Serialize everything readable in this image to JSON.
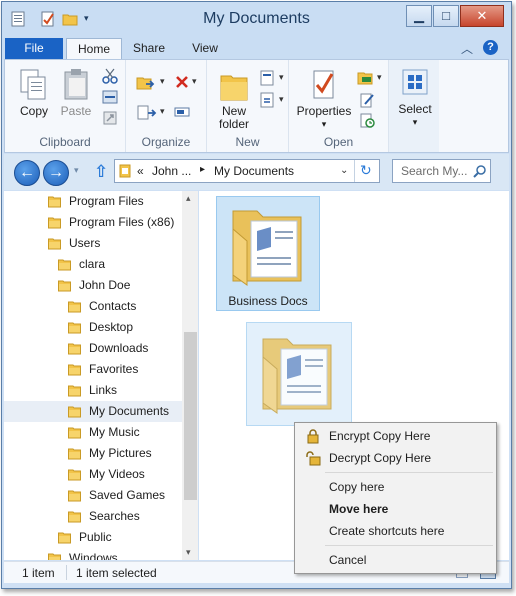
{
  "window": {
    "title": "My Documents"
  },
  "ribbon_tabs": [
    "File",
    "Home",
    "Share",
    "View"
  ],
  "ribbon": {
    "clipboard": {
      "copy": "Copy",
      "paste": "Paste",
      "group": "Clipboard"
    },
    "organize": {
      "group": "Organize"
    },
    "new": {
      "new_folder_line1": "New",
      "new_folder_line2": "folder",
      "group": "New"
    },
    "open": {
      "properties": "Properties",
      "group": "Open"
    },
    "select": {
      "label": "Select"
    }
  },
  "address": {
    "crumb_prefix": "«",
    "crumb1": "John ...",
    "separator": "▸",
    "crumb2": "My Documents",
    "search_placeholder": "Search My..."
  },
  "tree": [
    {
      "label": "Program Files",
      "level": 1
    },
    {
      "label": "Program Files (x86)",
      "level": 1
    },
    {
      "label": "Users",
      "level": 1
    },
    {
      "label": "clara",
      "level": 2
    },
    {
      "label": "John Doe",
      "level": 2
    },
    {
      "label": "Contacts",
      "level": 3
    },
    {
      "label": "Desktop",
      "level": 3
    },
    {
      "label": "Downloads",
      "level": 3
    },
    {
      "label": "Favorites",
      "level": 3
    },
    {
      "label": "Links",
      "level": 3
    },
    {
      "label": "My Documents",
      "level": 3,
      "selected": true
    },
    {
      "label": "My Music",
      "level": 3
    },
    {
      "label": "My Pictures",
      "level": 3
    },
    {
      "label": "My Videos",
      "level": 3
    },
    {
      "label": "Saved Games",
      "level": 3
    },
    {
      "label": "Searches",
      "level": 3
    },
    {
      "label": "Public",
      "level": 2
    },
    {
      "label": "Windows",
      "level": 1
    }
  ],
  "files": [
    {
      "name": "Business Docs",
      "selected": true
    },
    {
      "name": "",
      "dragging": true
    }
  ],
  "status": {
    "count": "1 item",
    "selection": "1 item selected"
  },
  "context_menu": {
    "items": [
      {
        "label": "Encrypt Copy Here",
        "icon": "lock-icon"
      },
      {
        "label": "Decrypt Copy Here",
        "icon": "unlock-icon"
      },
      {
        "label": "Copy here"
      },
      {
        "label": "Move here",
        "bold": true
      },
      {
        "label": "Create shortcuts here"
      },
      {
        "label": "Cancel"
      }
    ]
  },
  "colors": {
    "file_tab": "#1a63c5",
    "title_bar": "#c9ddf3",
    "selection": "#cce4f7"
  }
}
